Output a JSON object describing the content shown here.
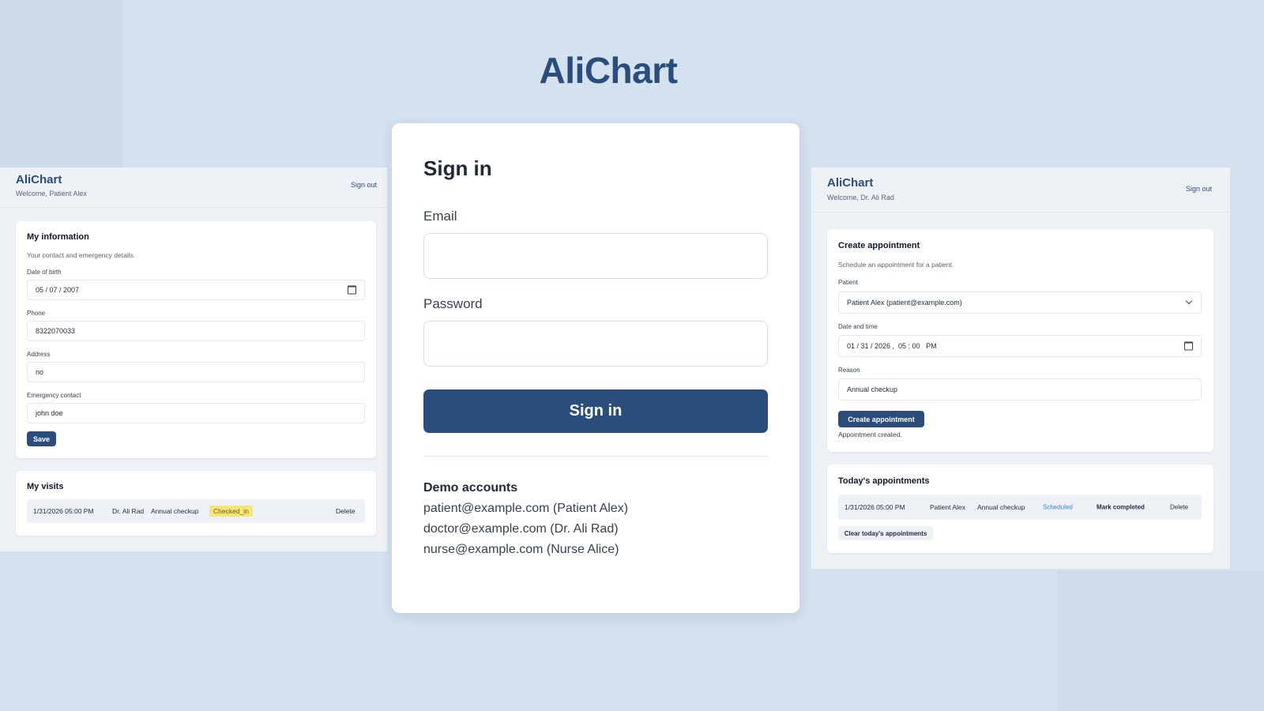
{
  "app_title": "AliChart",
  "left_panel": {
    "brand": "AliChart",
    "welcome": "Welcome, Patient Alex",
    "sign_out": "Sign out",
    "info": {
      "title": "My information",
      "subtitle": "Your contact and emergency details.",
      "dob_label": "Date of birth",
      "dob_value": "05 / 07 / 2007",
      "phone_label": "Phone",
      "phone_value": "8322070033",
      "address_label": "Address",
      "address_value": "no",
      "emergency_label": "Emergency contact",
      "emergency_value": "john doe",
      "save_label": "Save"
    },
    "visits": {
      "title": "My visits",
      "rows": [
        {
          "datetime": "1/31/2026 05:00 PM",
          "doctor": "Dr. Ali Rad",
          "reason": "Annual checkup",
          "status": "Checked_in",
          "delete": "Delete"
        }
      ]
    }
  },
  "sign_in": {
    "title": "Sign in",
    "email_label": "Email",
    "email_value": "",
    "password_label": "Password",
    "password_value": "",
    "button_label": "Sign in",
    "demo_title": "Demo accounts",
    "demo_accounts": [
      "patient@example.com (Patient Alex)",
      "doctor@example.com (Dr. Ali Rad)",
      "nurse@example.com (Nurse Alice)"
    ]
  },
  "right_panel": {
    "brand": "AliChart",
    "welcome": "Welcome, Dr. Ali Rad",
    "sign_out": "Sign out",
    "create": {
      "title": "Create appointment",
      "subtitle": "Schedule an appointment for a patient.",
      "patient_label": "Patient",
      "patient_value": "Patient Alex (patient@example.com)",
      "datetime_label": "Date and time",
      "datetime_value": "01 / 31 / 2026 ,  05 : 00   PM",
      "reason_label": "Reason",
      "reason_value": "Annual checkup",
      "button_label": "Create appointment",
      "status_message": "Appointment created."
    },
    "today": {
      "title": "Today's appointments",
      "rows": [
        {
          "datetime": "1/31/2026 05:00 PM",
          "patient": "Patient Alex",
          "reason": "Annual checkup",
          "status": "Scheduled",
          "mark_completed": "Mark completed",
          "delete": "Delete"
        }
      ],
      "clear_label": "Clear today's appointments"
    }
  },
  "colors": {
    "accent": "#2b4d7c",
    "background": "#d4e1ee",
    "badge_checked_in": "#f4e67a",
    "status_scheduled": "#3b82c4"
  }
}
